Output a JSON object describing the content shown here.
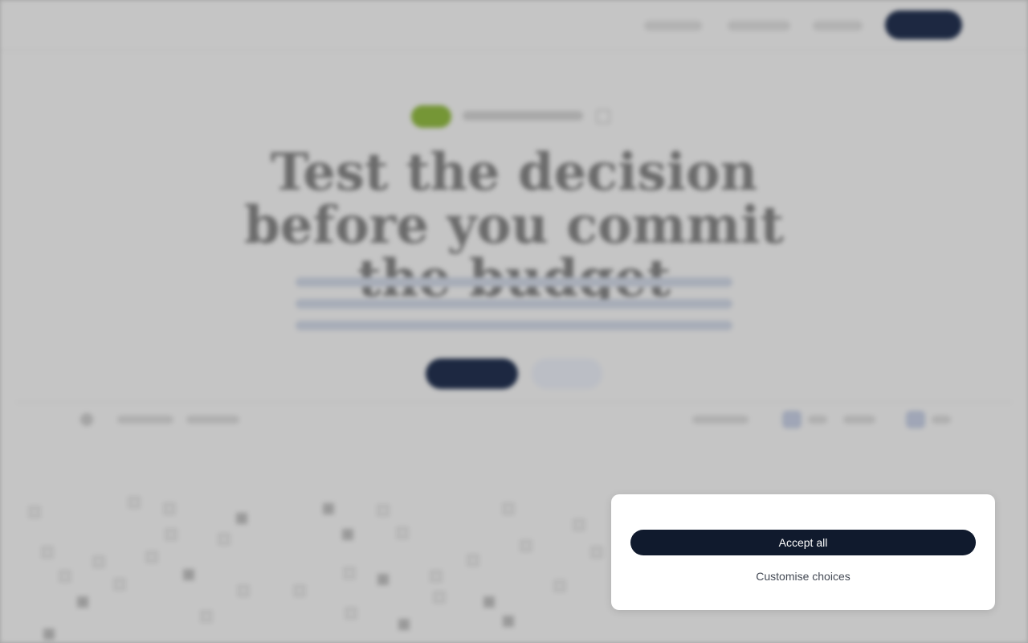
{
  "site": {
    "logo_text": "",
    "hero": {
      "title": "Test the decision before you commit the budget"
    }
  },
  "cookie_banner": {
    "accept_label": "Accept all",
    "customise_label": "Customise choices"
  },
  "colors": {
    "accent_dark": "#101a2d",
    "badge_green": "#8cb63c",
    "overlay": "rgba(35,35,35,0.22)"
  }
}
